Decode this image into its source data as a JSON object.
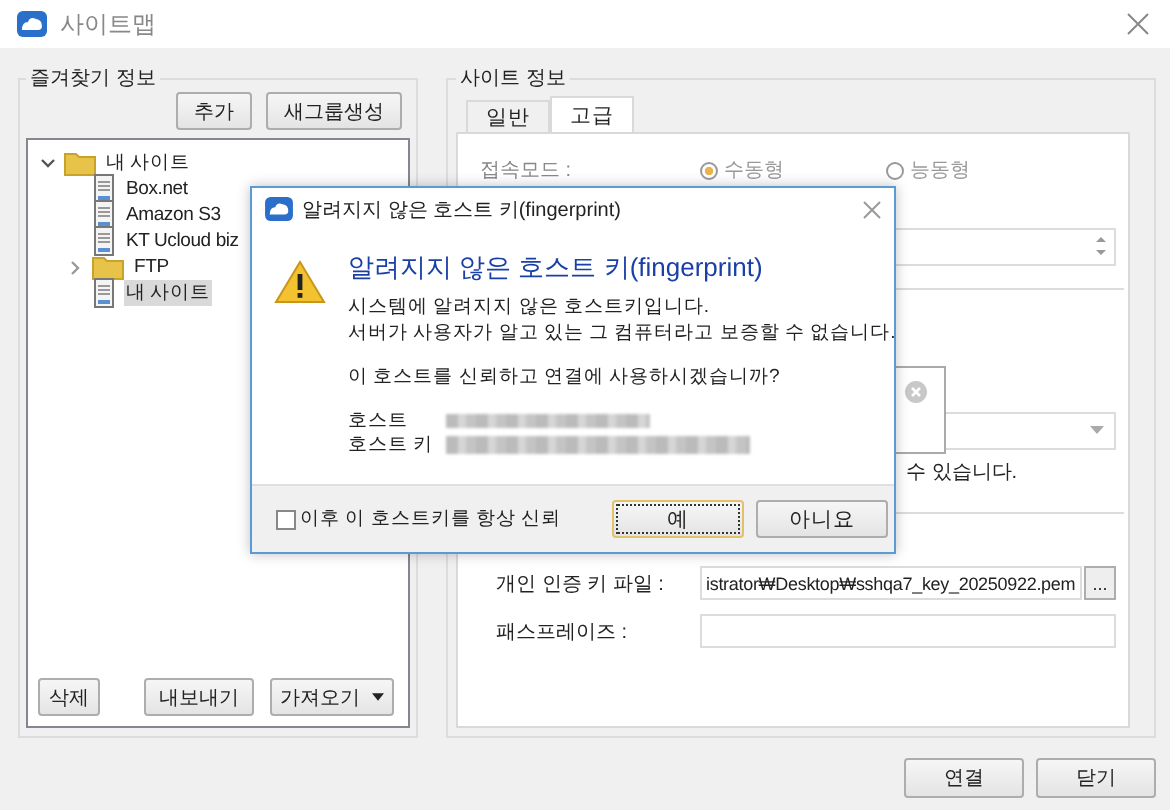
{
  "window": {
    "title": "사이트맵"
  },
  "favorites": {
    "title": "즐겨찾기 정보",
    "top_buttons": [
      "추가",
      "새그룹생성"
    ],
    "tree": [
      {
        "label": "내 사이트",
        "kind": "folder",
        "expanded": true,
        "selected": false,
        "children": [
          {
            "label": "Box.net",
            "kind": "site",
            "selected": false
          },
          {
            "label": "Amazon S3",
            "kind": "site",
            "selected": false
          },
          {
            "label": "KT Ucloud biz",
            "kind": "site",
            "selected": false
          },
          {
            "label": "FTP",
            "kind": "folder",
            "expanded": false,
            "selected": false
          },
          {
            "label": "내 사이트",
            "kind": "site",
            "selected": true
          }
        ]
      }
    ],
    "bottom_buttons": [
      {
        "label": "삭제",
        "dropdown": false
      },
      {
        "label": "내보내기",
        "dropdown": false
      },
      {
        "label": "가져오기",
        "dropdown": true
      }
    ]
  },
  "site_info": {
    "title": "사이트 정보",
    "tabs": [
      {
        "label": "일반",
        "selected": false
      },
      {
        "label": "고급",
        "selected": true
      }
    ],
    "connection_mode": {
      "label": "접속모드 :",
      "options": [
        {
          "label": "수동형",
          "selected": true,
          "disabled": true
        },
        {
          "label": "능동형",
          "selected": false,
          "disabled": true
        }
      ]
    },
    "note_fragment": "수 있습니다.",
    "key_file": {
      "label": "개인 인증 키 파일 :",
      "value": "istrator₩Desktop₩sshqa7_key_20250922.pem",
      "browse": "..."
    },
    "passphrase": {
      "label": "패스프레이즈 :"
    }
  },
  "footer_buttons": [
    "연결",
    "닫기"
  ],
  "dialog": {
    "title": "알려지지 않은 호스트 키(fingerprint)",
    "heading": "알려지지 않은 호스트 키(fingerprint)",
    "message": [
      "시스템에 알려지지 않은 호스트키입니다.",
      "서버가 사용자가 알고 있는 그 컴퓨터라고 보증할 수 없습니다."
    ],
    "question": "이 호스트를 신뢰하고 연결에 사용하시겠습니까?",
    "fields": [
      {
        "label": "호스트"
      },
      {
        "label": "호스트 키"
      }
    ],
    "always_trust": {
      "label": "이후 이 호스트키를 항상 신뢰",
      "checked": false
    },
    "buttons": [
      {
        "label": "예",
        "focused": true
      },
      {
        "label": "아니요",
        "focused": false
      }
    ]
  }
}
